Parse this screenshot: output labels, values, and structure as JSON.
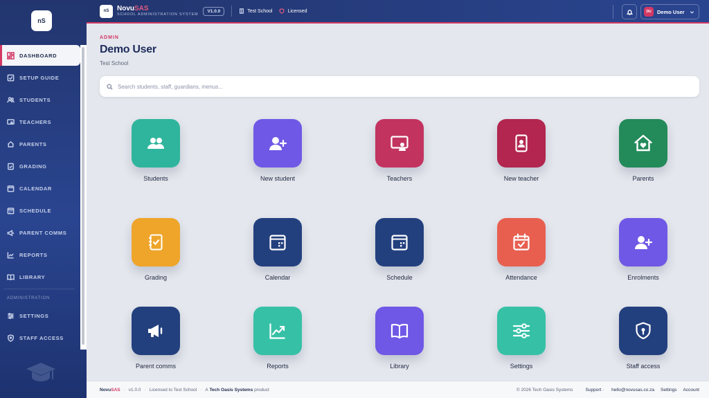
{
  "app": {
    "logo_text": "nS",
    "brand_main": "Novu",
    "brand_accent": "SAS",
    "tagline": "SCHOOL ADMINISTRATION SYSTEM",
    "version": "V1.0.0"
  },
  "header": {
    "school": "Test School",
    "license": "Licensed",
    "user_name": "Demo User",
    "user_initials": "DU"
  },
  "sidebar": {
    "items": [
      {
        "label": "DASHBOARD",
        "icon": "dashboard-icon",
        "active": true
      },
      {
        "label": "SETUP GUIDE",
        "icon": "guide-icon"
      },
      {
        "label": "STUDENTS",
        "icon": "students-icon"
      },
      {
        "label": "TEACHERS",
        "icon": "teachers-icon"
      },
      {
        "label": "PARENTS",
        "icon": "parents-icon"
      },
      {
        "label": "GRADING",
        "icon": "grading-icon"
      },
      {
        "label": "CALENDAR",
        "icon": "calendar-icon"
      },
      {
        "label": "SCHEDULE",
        "icon": "schedule-icon"
      },
      {
        "label": "PARENT COMMS",
        "icon": "megaphone-icon"
      },
      {
        "label": "REPORTS",
        "icon": "reports-icon"
      },
      {
        "label": "LIBRARY",
        "icon": "library-icon"
      }
    ],
    "section_label": "ADMINISTRATION",
    "admin_items": [
      {
        "label": "SETTINGS",
        "icon": "settings-icon"
      },
      {
        "label": "STAFF ACCESS",
        "icon": "shield-icon"
      }
    ]
  },
  "main": {
    "role": "ADMIN",
    "title": "Demo User",
    "school": "Test School",
    "search_placeholder": "Search students, staff, guardians, menus...",
    "tiles": [
      {
        "label": "Students",
        "icon": "students-icon",
        "color": "#2fb59d"
      },
      {
        "label": "New student",
        "icon": "add-user-icon",
        "color": "#6f58e6"
      },
      {
        "label": "Teachers",
        "icon": "teacher-board-icon",
        "color": "#c23360"
      },
      {
        "label": "New teacher",
        "icon": "id-badge-icon",
        "color": "#b2264f"
      },
      {
        "label": "Parents",
        "icon": "home-heart-icon",
        "color": "#238a5a"
      },
      {
        "label": "Grading",
        "icon": "clipboard-check-icon",
        "color": "#eea52a"
      },
      {
        "label": "Calendar",
        "icon": "calendar-icon",
        "color": "#23407e"
      },
      {
        "label": "Schedule",
        "icon": "schedule-icon",
        "color": "#23407e"
      },
      {
        "label": "Attendance",
        "icon": "calendar-check-icon",
        "color": "#e85f50"
      },
      {
        "label": "Enrolments",
        "icon": "add-user-icon",
        "color": "#6f58e6"
      },
      {
        "label": "Parent comms",
        "icon": "megaphone-icon",
        "color": "#23407e"
      },
      {
        "label": "Reports",
        "icon": "trend-chart-icon",
        "color": "#36c1a7"
      },
      {
        "label": "Library",
        "icon": "book-icon",
        "color": "#6f58e6"
      },
      {
        "label": "Settings",
        "icon": "sliders-icon",
        "color": "#36c1a7"
      },
      {
        "label": "Staff access",
        "icon": "shield-lock-icon",
        "color": "#23407e"
      }
    ]
  },
  "footer": {
    "brand_main": "Novu",
    "brand_accent": "SAS",
    "version": "v1.0.0",
    "licensed_to": "Licensed to Test School",
    "product_prefix": "A",
    "company": "Tech Oasis Systems",
    "product_suffix": "product",
    "copyright": "© 2026 Tech Oasis Systems",
    "support_label": "Support",
    "support_email": "hello@novusas.co.za",
    "settings_link": "Settings",
    "account_link": "Account"
  }
}
